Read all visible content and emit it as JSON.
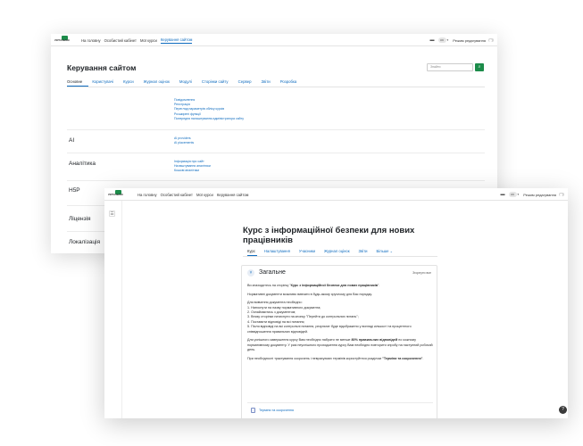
{
  "window1": {
    "nav": {
      "logo_text": "УКРГАЗБАНК",
      "items": [
        {
          "label": "На головну"
        },
        {
          "label": "Особистий кабінет"
        },
        {
          "label": "Мої курси"
        },
        {
          "label": "Керування сайтом"
        }
      ],
      "lang": "UK",
      "edit_mode_label": "Режим редагування"
    },
    "page_title": "Керування сайтом",
    "search_placeholder": "Знайти",
    "tabs": [
      {
        "label": "Основне"
      },
      {
        "label": "Користувачі"
      },
      {
        "label": "Курси"
      },
      {
        "label": "Журнал оцінок"
      },
      {
        "label": "Модулі"
      },
      {
        "label": "Сторінки сайту"
      },
      {
        "label": "Сервер"
      },
      {
        "label": "Звіти"
      },
      {
        "label": "Розробка"
      }
    ],
    "general_links": [
      "Повідомлення",
      "Реєстрація",
      "Перегляд параметрів обліку курсів",
      "Розширені функції",
      "Попередня налаштування адміністратора сайту"
    ],
    "sections": [
      {
        "label": "AI",
        "links": [
          "AI providers",
          "AI placements"
        ]
      },
      {
        "label": "Аналітика",
        "links": [
          "Інформація про сайт",
          "Налаштування аналітики",
          "Кошові аналітики"
        ]
      },
      {
        "label": "H5P",
        "links": []
      },
      {
        "label": "Ліцензія",
        "links": []
      },
      {
        "label": "Локалізація",
        "links": []
      }
    ]
  },
  "window2": {
    "nav": {
      "logo_text": "УКРГАЗБАНК",
      "items": [
        {
          "label": "На головну"
        },
        {
          "label": "Особистий кабінет"
        },
        {
          "label": "Мої курси"
        },
        {
          "label": "Керування сайтом"
        }
      ],
      "lang": "UK",
      "edit_mode_label": "Режим редагування"
    },
    "course_title": "Курс з інформаційної безпеки для нових працівників",
    "tabs": [
      {
        "label": "Курс"
      },
      {
        "label": "Налаштування"
      },
      {
        "label": "Учасники"
      },
      {
        "label": "Журнал оцінок"
      },
      {
        "label": "Звіти"
      },
      {
        "label": "Більше ⌄"
      }
    ],
    "section": {
      "title": "Загальне",
      "collapse_label": "Згорнути все",
      "p1_pre": "Ви знаходитесь на сторінці \"",
      "p1_bold": "Курс з інформаційної безпеки для нових працівників",
      "p1_post": "\".",
      "p2": "Нормативні документи можливо вивчати в будь-якому зручному для Вас порядку.",
      "steps_title": "Для вивчення документа необхідно:",
      "step1": "1. Натиснути на назву нормативного документа;",
      "step2": "2. Ознайомитись з документом;",
      "step3": "3. Внизу сторінки натиснути на кнопку \"Перейти до контрольних питань\";",
      "step4": "4. Поставити відповіді на всі питання;",
      "step5": "5. Після відповіді на всі контрольні питання, результат буде відображено у вигляді кількості та процентного співвідношення правильних відповідей.",
      "p4_pre": "Для успішного завершення курсу Вам необхідно набрати не менше ",
      "p4_bold": "80% правильних відповідей",
      "p4_post": " по кожному нормативному документу. У разі неуспішного проходження курсу Вам необхідно повторити спробу на наступний робочий день.",
      "p5_pre": "При необхідності трактування скорочень і неврахуємих термінів користуйтеся розділом ",
      "p5_bold": "\"Терміни та скорочення\"",
      "p5_post": ".",
      "resource_label": "Терміни та скорочення"
    }
  }
}
